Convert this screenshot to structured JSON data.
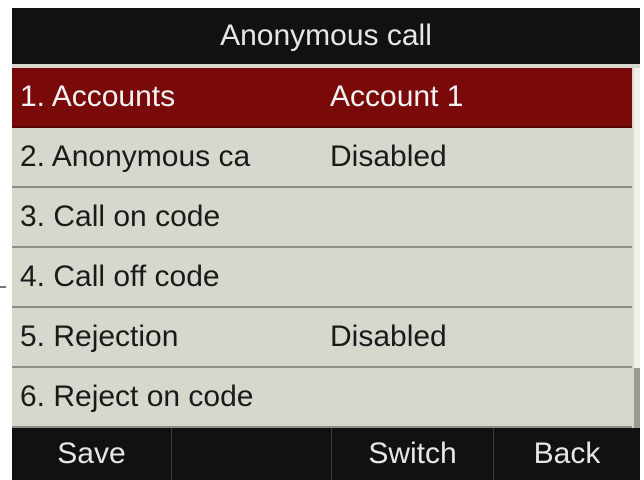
{
  "header": {
    "title": "Anonymous call"
  },
  "colors": {
    "selected_row": "#7a0a0a",
    "list_bg": "#d8d7ce",
    "bars": "#111111"
  },
  "menu": {
    "selected_index": 0,
    "items": [
      {
        "label": "1. Accounts",
        "value": "Account 1"
      },
      {
        "label": "2. Anonymous ca",
        "value": "Disabled"
      },
      {
        "label": "3. Call on code",
        "value": ""
      },
      {
        "label": "4. Call off code",
        "value": ""
      },
      {
        "label": "5. Rejection",
        "value": "Disabled"
      },
      {
        "label": "6. Reject on code",
        "value": ""
      }
    ]
  },
  "softkeys": {
    "key1": "Save",
    "key2": "",
    "key3": "Switch",
    "key4": "Back"
  }
}
